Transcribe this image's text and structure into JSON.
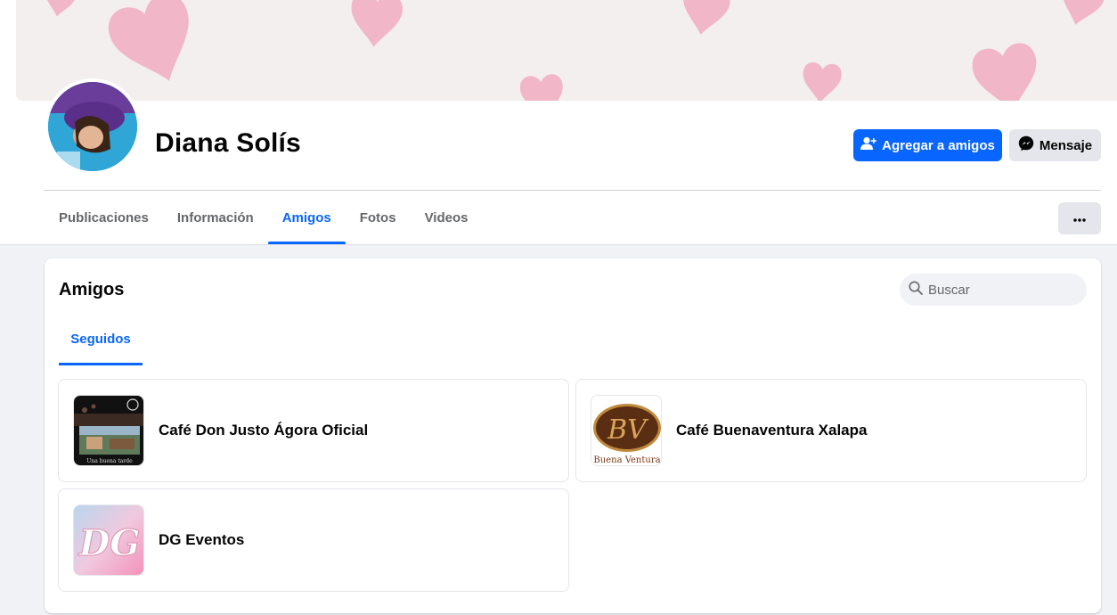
{
  "profile": {
    "name": "Diana Solís"
  },
  "actions": {
    "add_friend_label": "Agregar a amigos",
    "message_label": "Mensaje"
  },
  "nav": {
    "tabs": [
      {
        "label": "Publicaciones",
        "active": false
      },
      {
        "label": "Información",
        "active": false
      },
      {
        "label": "Amigos",
        "active": true
      },
      {
        "label": "Fotos",
        "active": false
      },
      {
        "label": "Videos",
        "active": false
      }
    ],
    "more_icon": "ellipsis-icon"
  },
  "friends_section": {
    "title": "Amigos",
    "search_placeholder": "Buscar",
    "subtab_label": "Seguidos",
    "items": [
      {
        "name": "Café Don Justo Ágora Oficial",
        "thumb_caption": "Una buena tarde"
      },
      {
        "name": "Café Buenaventura Xalapa",
        "thumb_caption": "Buena Ventura",
        "thumb_logo": "BV"
      },
      {
        "name": "DG Eventos",
        "thumb_logo": "DG"
      }
    ]
  },
  "colors": {
    "accent": "#0866ff",
    "page_bg": "#f0f2f5",
    "secondary_button": "#e4e6eb",
    "muted_text": "#65676b"
  }
}
